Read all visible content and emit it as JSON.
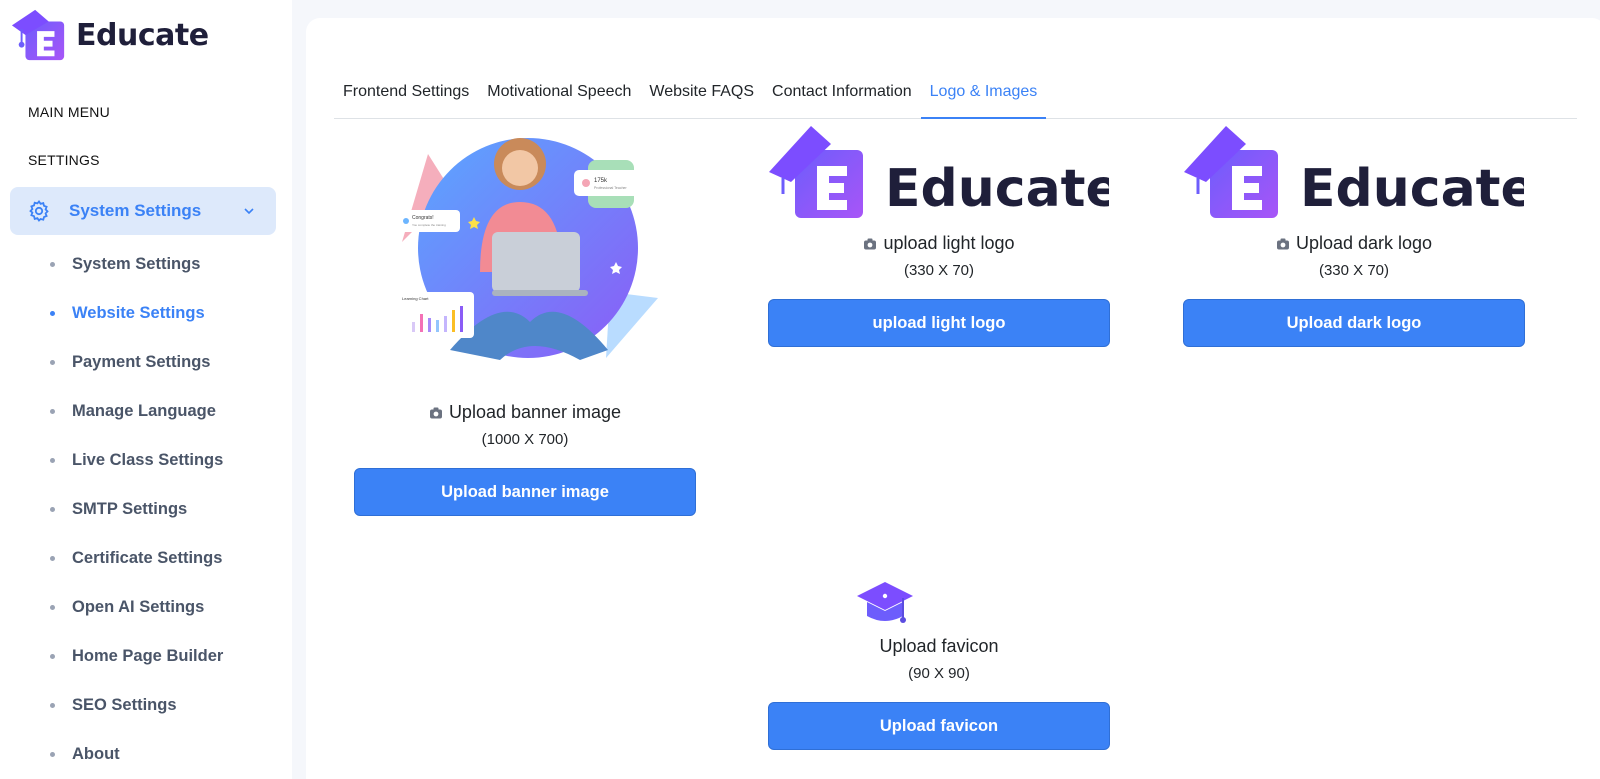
{
  "brand": {
    "name": "Educate"
  },
  "sidebar": {
    "main_menu": "MAIN MENU",
    "settings": "SETTINGS",
    "active_parent": "System Settings",
    "items": [
      {
        "label": "System Settings",
        "active": false
      },
      {
        "label": "Website Settings",
        "active": true
      },
      {
        "label": "Payment Settings",
        "active": false
      },
      {
        "label": "Manage Language",
        "active": false
      },
      {
        "label": "Live Class Settings",
        "active": false
      },
      {
        "label": "SMTP Settings",
        "active": false
      },
      {
        "label": "Certificate Settings",
        "active": false
      },
      {
        "label": "Open AI Settings",
        "active": false
      },
      {
        "label": "Home Page Builder",
        "active": false
      },
      {
        "label": "SEO Settings",
        "active": false
      },
      {
        "label": "About",
        "active": false
      }
    ]
  },
  "tabs": [
    {
      "label": "Frontend Settings",
      "active": false
    },
    {
      "label": "Motivational Speech",
      "active": false
    },
    {
      "label": "Website FAQS",
      "active": false
    },
    {
      "label": "Contact Information",
      "active": false
    },
    {
      "label": "Logo & Images",
      "active": true
    }
  ],
  "banner": {
    "caption": "Upload banner image",
    "dims": "(1000 X 700)",
    "button": "Upload banner image"
  },
  "light_logo": {
    "logo_text": "Educate",
    "caption": "upload light logo",
    "dims": "(330 X 70)",
    "button": "upload light logo"
  },
  "dark_logo": {
    "logo_text": "Educate",
    "caption": "Upload dark logo",
    "dims": "(330 X 70)",
    "button": "Upload dark logo"
  },
  "favicon": {
    "caption": "Upload favicon",
    "dims": "(90 X 90)",
    "button": "Upload favicon"
  },
  "colors": {
    "accent": "#3b82f6",
    "active_bg": "#dde9fb",
    "brand_purple": "#7c4dff",
    "page_bg": "#f5f7fb"
  },
  "banner_illustration": {
    "card1_title": "Congrats!",
    "card1_sub": "You complete the training",
    "card2_title": "175k",
    "card2_sub": "Professional Teacher",
    "chart_title": "Learning Chart"
  }
}
